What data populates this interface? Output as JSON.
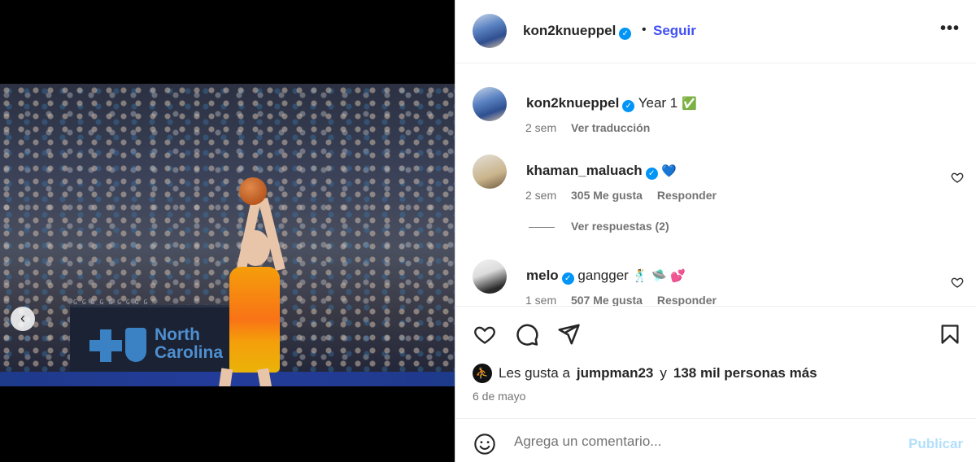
{
  "post": {
    "username": "kon2knueppel",
    "dot": "•",
    "follow_label": "Seguir",
    "more_label": "•••"
  },
  "media": {
    "banner_text_line1": "North",
    "banner_text_line2": "Carolina",
    "carousel_count": 7,
    "carousel_active_index": 6,
    "prev_label": "‹"
  },
  "caption": {
    "username": "kon2knueppel",
    "text": "Year 1",
    "emoji": "✅",
    "time": "2 sem",
    "translate_label": "Ver traducción"
  },
  "comments": [
    {
      "username": "khaman_maluach",
      "text": "",
      "emoji": "💙",
      "time": "2 sem",
      "likes": "305 Me gusta",
      "reply_label": "Responder"
    },
    {
      "username": "melo",
      "text": "gangger",
      "emoji": "🕺 🛸 💕",
      "time": "1 sem",
      "likes": "507 Me gusta",
      "reply_label": "Responder"
    }
  ],
  "view_replies_label": "Ver respuestas (2)",
  "likes": {
    "prefix": "Les gusta a",
    "user": "jumpman23",
    "connector": "y",
    "rest": "138 mil personas más"
  },
  "date": "6 de mayo",
  "add_comment": {
    "placeholder": "Agrega un comentario...",
    "publish_label": "Publicar"
  },
  "colors": {
    "accent": "#4150f7",
    "verified": "#0095f6",
    "publish_disabled": "#b2dffc",
    "muted": "#737373"
  }
}
